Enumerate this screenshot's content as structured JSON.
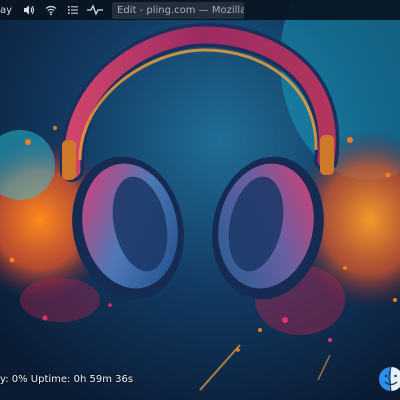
{
  "panel": {
    "applet_label": "ay",
    "icons": {
      "volume": "volume-icon",
      "network": "wifi-icon",
      "menu": "list-menu-icon",
      "monitor": "activity-pulse-icon"
    },
    "task_title": "Edit - pling.com — Mozilla ..."
  },
  "desktop": {
    "sysmon_line": "y: 0%  Uptime: 0h 59m 36s",
    "dock_icon": "finder-icon",
    "wallpaper_subject": "headphones-icon"
  },
  "colors": {
    "panel_bg": "#081420",
    "panel_text": "#d9dde2",
    "wallpaper_bg": "#0e2a4a",
    "accent_cyan": "#18b9d6",
    "accent_magenta": "#e0336c",
    "accent_orange": "#f08a24"
  }
}
